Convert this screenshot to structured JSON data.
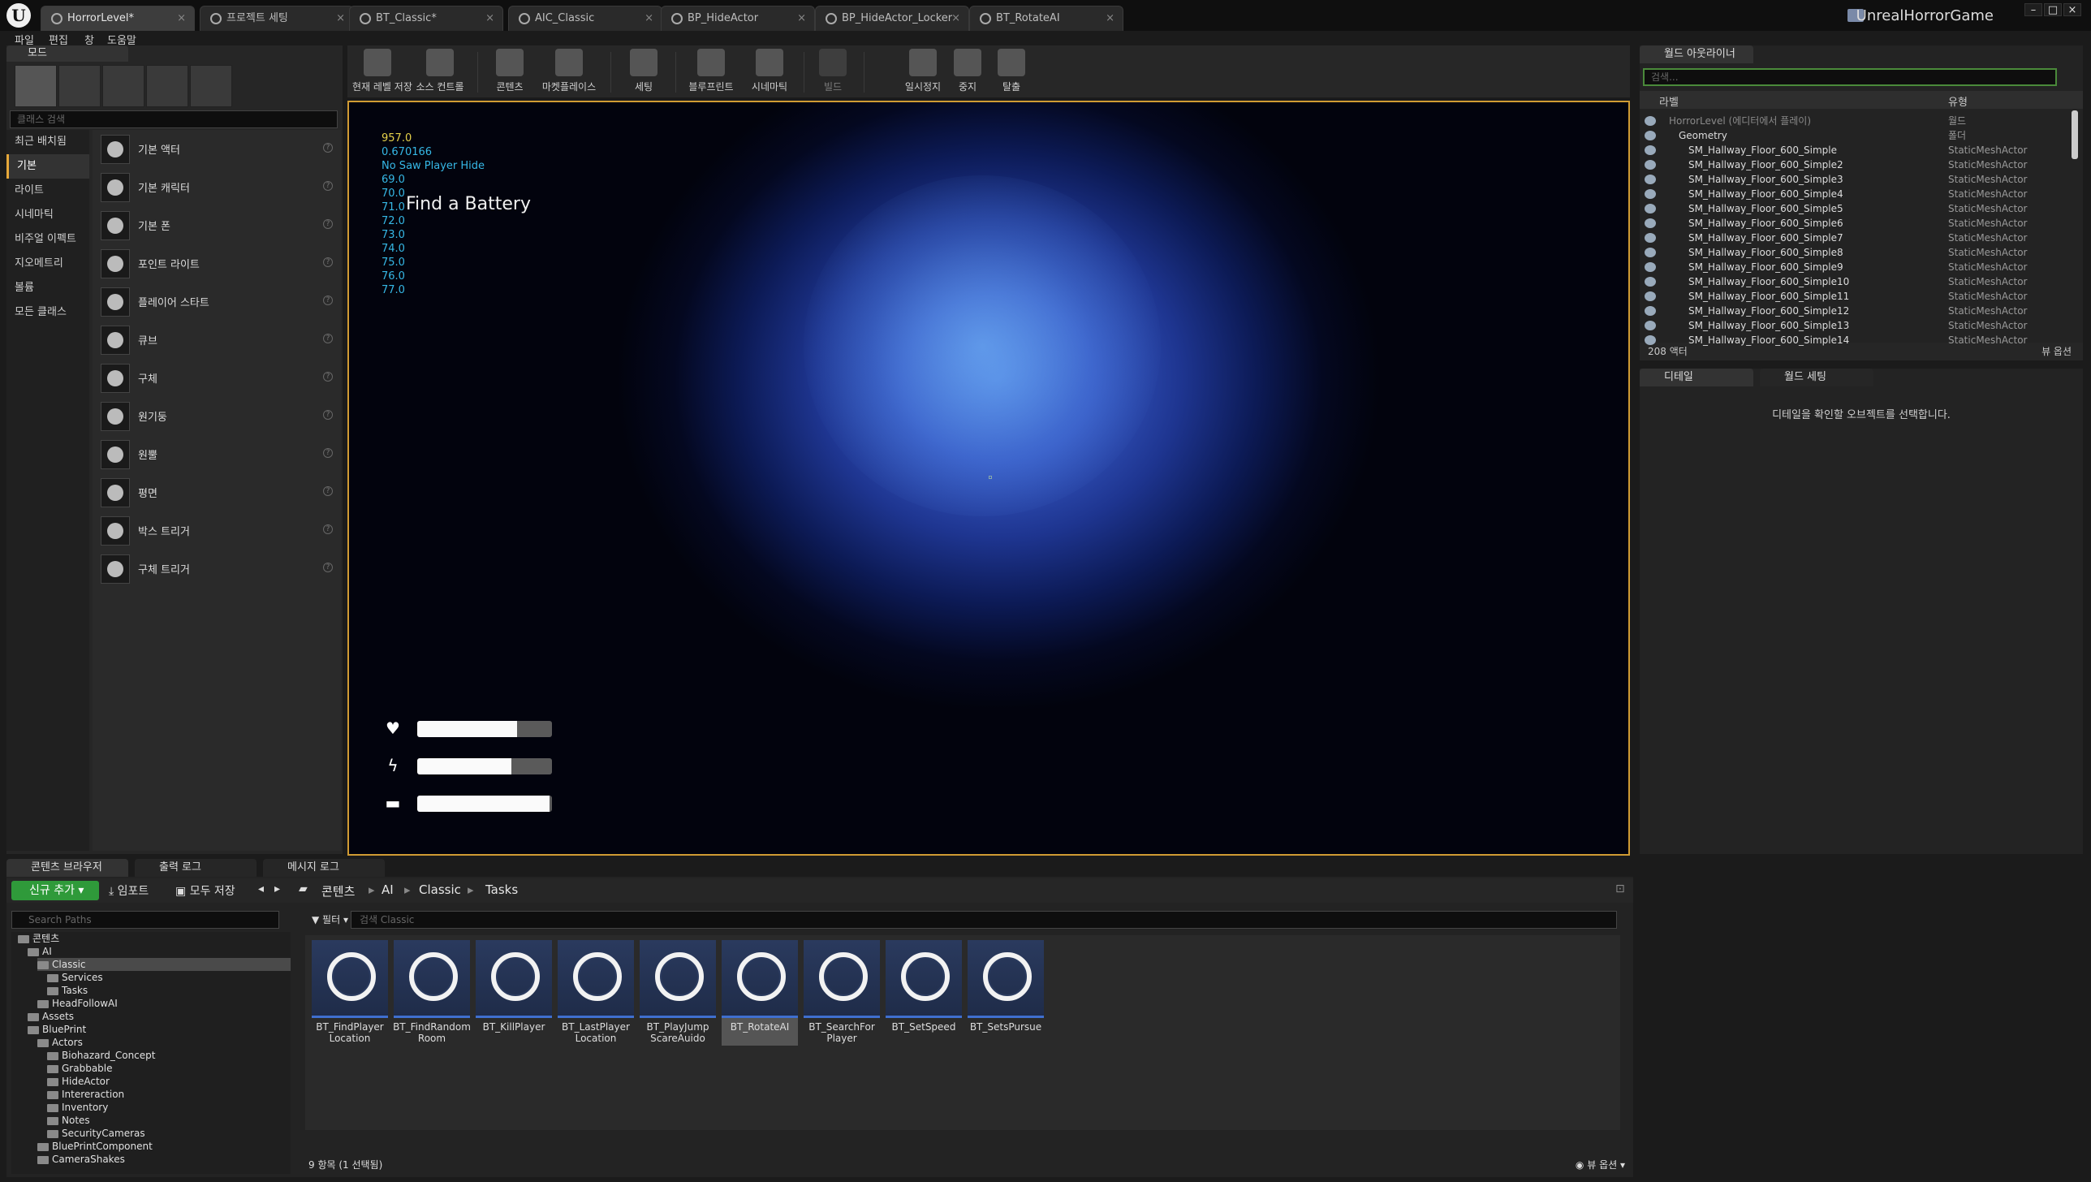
{
  "title_bar": {
    "tabs": [
      {
        "label": "HorrorLevel*",
        "active": true
      },
      {
        "label": "프로젝트 세팅"
      },
      {
        "label": "BT_Classic*"
      },
      {
        "label": "AIC_Classic"
      },
      {
        "label": "BP_HideActor"
      },
      {
        "label": "BP_HideActor_Locker"
      },
      {
        "label": "BT_RotateAI"
      }
    ],
    "project_name": "UnrealHorrorGame"
  },
  "menu": [
    "파일",
    "편집",
    "창",
    "도움말"
  ],
  "modes": {
    "tab_label": "모드",
    "search_placeholder": "클래스 검색",
    "categories": [
      "최근 배치됨",
      "기본",
      "라이트",
      "시네마틱",
      "비주얼 이펙트",
      "지오메트리",
      "볼륨",
      "모든 클래스"
    ],
    "active_category": "기본",
    "items": [
      "기본 액터",
      "기본 캐릭터",
      "기본 폰",
      "포인트 라이트",
      "플레이어 스타트",
      "큐브",
      "구체",
      "원기둥",
      "원뿔",
      "평면",
      "박스 트리거",
      "구체 트리거"
    ]
  },
  "toolbar": {
    "buttons": [
      "현재 레벨 저장",
      "소스 컨트롤",
      "콘텐츠",
      "마켓플레이스",
      "세팅",
      "블루프린트",
      "시네마틱",
      "빌드",
      "일시정지",
      "중지",
      "탈출"
    ]
  },
  "viewport": {
    "debug_lines": [
      "957.0",
      "0.670166",
      "No Saw Player Hide",
      "69.0",
      "70.0",
      "71.0",
      "72.0",
      "73.0",
      "74.0",
      "75.0",
      "76.0",
      "77.0"
    ],
    "objective": "Find a Battery",
    "stats": [
      {
        "icon": "heart-icon",
        "fill": 0.74
      },
      {
        "icon": "lightning-icon",
        "fill": 0.7
      },
      {
        "icon": "battery-icon",
        "fill": 0.98
      }
    ]
  },
  "outliner": {
    "tab_label": "월드 아웃라이너",
    "search_placeholder": "검색...",
    "col_label": "라벨",
    "col_type": "유형",
    "rows": [
      {
        "name": "HorrorLevel (에디터에서 플레이)",
        "type": "월드",
        "indent": 0
      },
      {
        "name": "Geometry",
        "type": "폴더",
        "indent": 1
      },
      {
        "name": "SM_Hallway_Floor_600_Simple",
        "type": "StaticMeshActor",
        "indent": 2
      },
      {
        "name": "SM_Hallway_Floor_600_Simple2",
        "type": "StaticMeshActor",
        "indent": 2
      },
      {
        "name": "SM_Hallway_Floor_600_Simple3",
        "type": "StaticMeshActor",
        "indent": 2
      },
      {
        "name": "SM_Hallway_Floor_600_Simple4",
        "type": "StaticMeshActor",
        "indent": 2
      },
      {
        "name": "SM_Hallway_Floor_600_Simple5",
        "type": "StaticMeshActor",
        "indent": 2
      },
      {
        "name": "SM_Hallway_Floor_600_Simple6",
        "type": "StaticMeshActor",
        "indent": 2
      },
      {
        "name": "SM_Hallway_Floor_600_Simple7",
        "type": "StaticMeshActor",
        "indent": 2
      },
      {
        "name": "SM_Hallway_Floor_600_Simple8",
        "type": "StaticMeshActor",
        "indent": 2
      },
      {
        "name": "SM_Hallway_Floor_600_Simple9",
        "type": "StaticMeshActor",
        "indent": 2
      },
      {
        "name": "SM_Hallway_Floor_600_Simple10",
        "type": "StaticMeshActor",
        "indent": 2
      },
      {
        "name": "SM_Hallway_Floor_600_Simple11",
        "type": "StaticMeshActor",
        "indent": 2
      },
      {
        "name": "SM_Hallway_Floor_600_Simple12",
        "type": "StaticMeshActor",
        "indent": 2
      },
      {
        "name": "SM_Hallway_Floor_600_Simple13",
        "type": "StaticMeshActor",
        "indent": 2
      },
      {
        "name": "SM_Hallway_Floor_600_Simple14",
        "type": "StaticMeshActor",
        "indent": 2
      }
    ],
    "actor_count": "208 액터",
    "view_options": "뷰 옵션"
  },
  "details": {
    "tab_details": "디테일",
    "tab_world": "월드 세팅",
    "empty_message": "디테일을 확인할 오브젝트를 선택합니다."
  },
  "content_browser": {
    "tabs": [
      "콘텐츠 브라우저",
      "출력 로그",
      "메시지 로그"
    ],
    "add_new": "신규 추가",
    "import": "임포트",
    "save_all": "모두 저장",
    "breadcrumbs": [
      "콘텐츠",
      "AI",
      "Classic",
      "Tasks"
    ],
    "paths_placeholder": "Search Paths",
    "filter_label": "필터",
    "asset_search_placeholder": "검색 Classic",
    "tree": [
      {
        "label": "콘텐츠",
        "indent": 0
      },
      {
        "label": "AI",
        "indent": 1
      },
      {
        "label": "Classic",
        "indent": 2,
        "selected": true
      },
      {
        "label": "Services",
        "indent": 3
      },
      {
        "label": "Tasks",
        "indent": 3
      },
      {
        "label": "HeadFollowAI",
        "indent": 2
      },
      {
        "label": "Assets",
        "indent": 1
      },
      {
        "label": "BluePrint",
        "indent": 1
      },
      {
        "label": "Actors",
        "indent": 2
      },
      {
        "label": "Biohazard_Concept",
        "indent": 3
      },
      {
        "label": "Grabbable",
        "indent": 3
      },
      {
        "label": "HideActor",
        "indent": 3
      },
      {
        "label": "Intereraction",
        "indent": 3
      },
      {
        "label": "Inventory",
        "indent": 3
      },
      {
        "label": "Notes",
        "indent": 3
      },
      {
        "label": "SecurityCameras",
        "indent": 3
      },
      {
        "label": "BluePrintComponent",
        "indent": 2
      },
      {
        "label": "CameraShakes",
        "indent": 2
      }
    ],
    "assets": [
      {
        "label": "BT_FindPlayer Location"
      },
      {
        "label": "BT_FindRandom Room"
      },
      {
        "label": "BT_KillPlayer"
      },
      {
        "label": "BT_LastPlayer Location"
      },
      {
        "label": "BT_PlayJump ScareAuido"
      },
      {
        "label": "BT_RotateAI",
        "selected": true
      },
      {
        "label": "BT_SearchFor Player"
      },
      {
        "label": "BT_SetSpeed"
      },
      {
        "label": "BT_SetsPursue"
      }
    ],
    "status": "9 항목 (1 선택됨)",
    "view_options": "뷰 옵션"
  },
  "colors": {
    "accent": "#d09b33",
    "add_button": "#2f9a3a",
    "debug_text": "#36b8e6",
    "debug_highlight": "#e6d24a"
  }
}
